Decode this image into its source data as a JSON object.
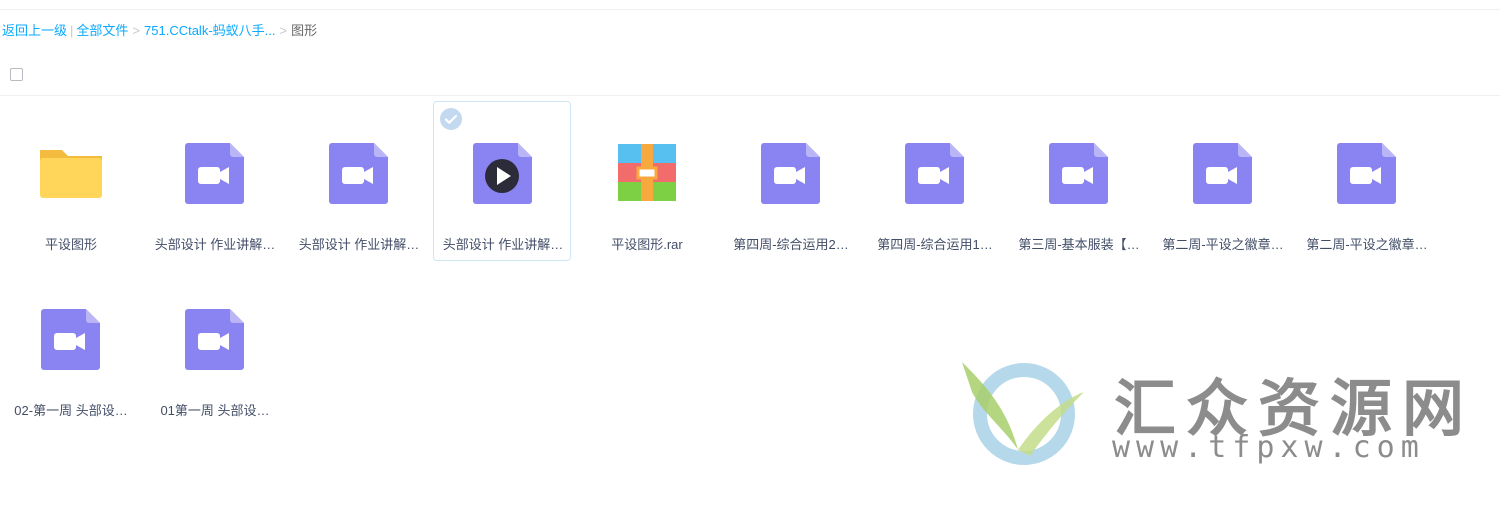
{
  "breadcrumb": {
    "back": "返回上一级",
    "pipe": "|",
    "all_files": "全部文件",
    "folder": "751.CCtalk-蚂蚁八手...",
    "current": "图形",
    "separator": ">"
  },
  "files": [
    {
      "name": "平设图形",
      "type": "folder"
    },
    {
      "name": "头部设计 作业讲解…",
      "type": "video"
    },
    {
      "name": "头部设计 作业讲解…",
      "type": "video"
    },
    {
      "name": "头部设计 作业讲解…",
      "type": "video",
      "selected": true
    },
    {
      "name": "平设图形.rar",
      "type": "rar"
    },
    {
      "name": "第四周-综合运用2…",
      "type": "video"
    },
    {
      "name": "第四周-综合运用1…",
      "type": "video"
    },
    {
      "name": "第三周-基本服装【…",
      "type": "video"
    },
    {
      "name": "第二周-平设之徽章…",
      "type": "video"
    },
    {
      "name": "第二周-平设之徽章…",
      "type": "video"
    },
    {
      "name": "02-第一周 头部设…",
      "type": "video"
    },
    {
      "name": "01第一周 头部设…",
      "type": "video"
    }
  ],
  "watermark": {
    "title": "汇众资源网",
    "url": "www.tfpxw.com"
  },
  "colors": {
    "link": "#09AAFF",
    "video_icon": "#8A84F2",
    "folder_icon": "#FFD659"
  },
  "icons": {
    "folder": "folder-icon",
    "video": "video-file-icon",
    "rar": "archive-file-icon",
    "check": "check-circle-icon",
    "play": "play-icon"
  }
}
